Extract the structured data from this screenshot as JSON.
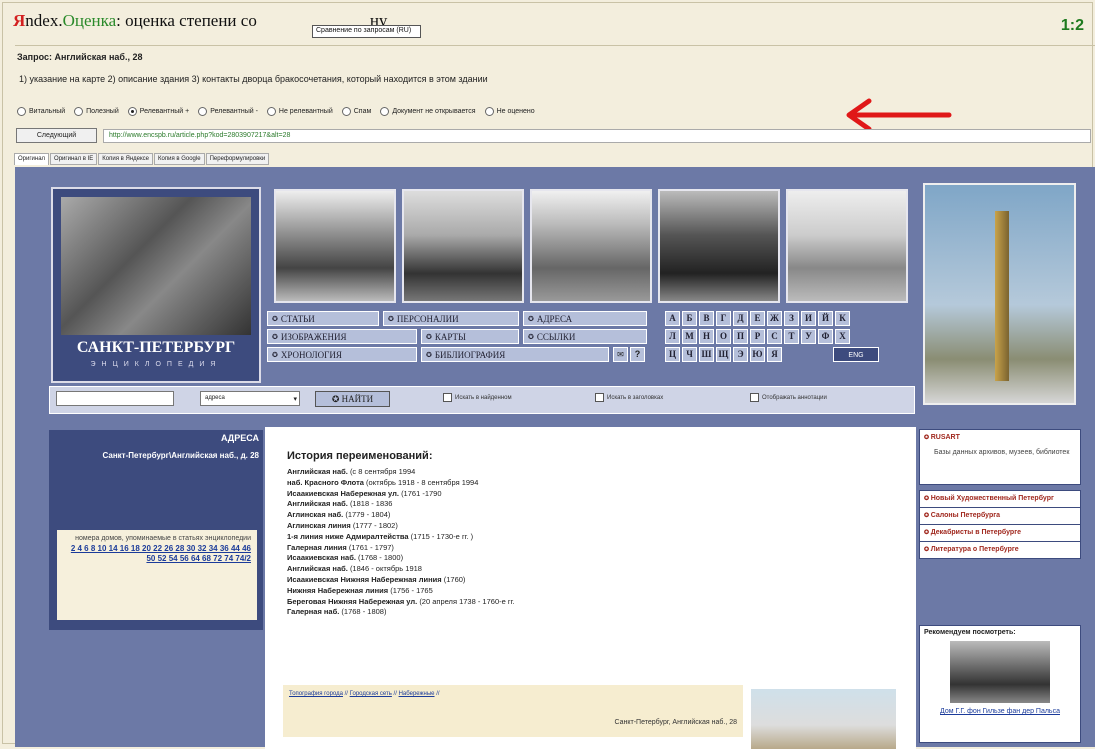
{
  "header": {
    "brand_y": "Я",
    "brand_ndex": "ndex.",
    "brand_ocenka": "Оценка",
    "title_part1": ": оценка степени со",
    "title_part2": "ну",
    "tooltip": "Сравнение по запросам (RU)",
    "score": "1:2"
  },
  "query": {
    "label": "Запрос: Английская наб., 28",
    "description": "1) указание на карте 2) описание здания 3) контакты дворца бракосочетания, который находится в этом здании"
  },
  "ratings": {
    "options": [
      "Витальный",
      "Полезный",
      "Релевантный +",
      "Релевантный -",
      "Не релевантный",
      "Спам",
      "Документ не открывается",
      "Не оценено"
    ],
    "selected": "Релевантный +"
  },
  "nav": {
    "next_label": "Следующий",
    "url": "http://www.encspb.ru/article.php?kod=2803907217&alt=28"
  },
  "tabs": [
    "Оригинал",
    "Оригинал в IE",
    "Копия в Яндексе",
    "Копия в Google",
    "Переформулировки"
  ],
  "site": {
    "logo_title": "САНКТ-ПЕТЕРБУРГ",
    "logo_subtitle": "ЭНЦИКЛОПЕДИЯ",
    "menu": {
      "statyi": "СТАТЬИ",
      "personalii": "ПЕРСОНАЛИИ",
      "adresa": "АДРЕСА",
      "izobrazheniya": "ИЗОБРАЖЕНИЯ",
      "karty": "КАРТЫ",
      "ssylki": "ССЫЛКИ",
      "hronologiya": "ХРОНОЛОГИЯ",
      "bibliografiya": "БИБЛИОГРАФИЯ",
      "help": "?"
    },
    "alphabet": [
      "А",
      "Б",
      "В",
      "Г",
      "Д",
      "Е",
      "Ж",
      "З",
      "И",
      "Й",
      "К",
      "Л",
      "М",
      "Н",
      "О",
      "П",
      "Р",
      "С",
      "Т",
      "У",
      "Ф",
      "Х",
      "Ц",
      "Ч",
      "Ш",
      "Щ",
      "Э",
      "Ю",
      "Я"
    ],
    "eng_label": "ENG",
    "search": {
      "select_value": "адреса",
      "button": "НАЙТИ",
      "check1": "Искать в найденном",
      "check2": "Искать в заголовках",
      "check3": "Отображать аннотации"
    },
    "left_panel": {
      "heading": "АДРЕСА",
      "address": "Санкт-Петербург\\Английская наб., д. 28",
      "note": "номера домов, упоминаемые в статьях энциклопедии",
      "house_numbers": "2 4 6 8 10 14 16 18 20 22 26 28 30 32 34 36 44 46 50 52 54 56 64 68 72 74 74/2"
    },
    "content": {
      "title": "История переименований:",
      "entries": [
        {
          "name": "Английская наб.",
          "period": "(с 8 сентября 1994"
        },
        {
          "name": "наб. Красного Флота",
          "period": "(октябрь 1918 - 8 сентября 1994"
        },
        {
          "name": "Исаакиевская Набережная ул.",
          "period": "(1761 -1790"
        },
        {
          "name": "Английская наб.",
          "period": "(1818 - 1836"
        },
        {
          "name": "Аглинская наб.",
          "period": "(1779 - 1804)"
        },
        {
          "name": "Аглинская линия",
          "period": "(1777 - 1802)"
        },
        {
          "name": "1-я линия ниже Адмиралтейства",
          "period": "(1715 - 1730-е гг. )"
        },
        {
          "name": "Галерная линия",
          "period": "(1761 - 1797)"
        },
        {
          "name": "Исаакиевская наб.",
          "period": "(1768 - 1800)"
        },
        {
          "name": "Английская наб.",
          "period": "(1846 - октябрь 1918"
        },
        {
          "name": "Исаакиевская Нижняя Набережная линия",
          "period": "(1760)"
        },
        {
          "name": "Нижняя Набережная линия",
          "period": "(1756 - 1765"
        },
        {
          "name": "Береговая Нижняя Набережная ул.",
          "period": "(20 апреля 1738 - 1760-е гг."
        },
        {
          "name": "Галерная наб.",
          "period": "(1768 - 1808)"
        }
      ],
      "links": [
        "Топография города",
        "Городская сеть",
        "Набережные"
      ],
      "footer_address": "Санкт-Петербург, Английская наб., 28"
    },
    "right_panel": {
      "rusart_label": "RUSART",
      "rusart_desc": "Базы данных архивов, музеев, библиотек",
      "links": [
        "Новый Художественный Петербург",
        "Салоны Петербурга",
        "Декабристы в Петербурге",
        "Литература о Петербурге"
      ],
      "recommend_heading": "Рекомендуем посмотреть:",
      "recommend_caption": "Дом Г.Г. фон Гильзе фан дер Пальса"
    }
  }
}
